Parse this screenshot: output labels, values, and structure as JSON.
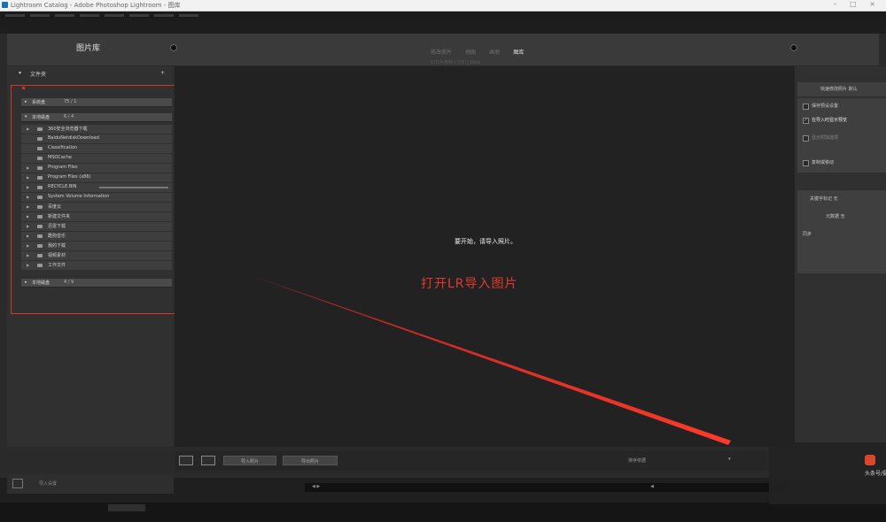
{
  "window": {
    "title": "Lightroom Catalog - Adobe Photoshop Lightroom - 图库",
    "controls": "– □ ×"
  },
  "identity": {
    "label": "图片库"
  },
  "modules": {
    "items": [
      "修改照片",
      "地图",
      "画册"
    ],
    "active": "图库",
    "sub": "幻灯片放映 | 打印 | Web"
  },
  "left_panel": {
    "header": "文件夹",
    "header_tri": "▾",
    "add": "+",
    "volumes": [
      {
        "name": "系统盘",
        "size": "75 / 1"
      },
      {
        "name": "本地磁盘",
        "size": "6 / 4"
      },
      {
        "name": "本地磁盘",
        "size": "4 / 9"
      }
    ],
    "folders": [
      "360安全浏览器下载",
      "BaiduNetdiskDownload",
      "Classification",
      "MSOCache",
      "Program Files",
      "Program Files (x86)",
      "RECYCLE.BIN",
      "System Volume Information",
      "百度云",
      "新建文件夹",
      "迅雷下载",
      "酷狗音乐",
      "我的下载",
      "视频素材",
      "工作文件"
    ]
  },
  "center": {
    "empty_message": "要开始，请导入照片。",
    "annotation": "打开LR导入图片"
  },
  "right_panel": {
    "quick_develop": "快速修改照片  默认",
    "options": [
      {
        "label": "保存预设设置",
        "checked": false
      },
      {
        "label": "在导入时显示预览",
        "checked": true
      },
      {
        "label": "显示附加选项",
        "checked": false
      },
      {
        "label": "复制或移动",
        "checked": false
      }
    ],
    "keywords": "关键字标记  无",
    "metadata": "元数据  无",
    "sync": "同步"
  },
  "toolbar": {
    "import_button": "导入照片",
    "export_button": "导出照片",
    "sort_label": "排序依据",
    "sort_tri": "▾"
  },
  "left_bottom": {
    "label": "导入设置"
  },
  "filmstrip": {
    "left_text": "◀  ▶",
    "right_text": "◀"
  },
  "watermark": {
    "text": "头条号/摄影"
  },
  "colors": {
    "annotation_red": "#d9322c",
    "panel_bg": "#303030",
    "grid_bg": "#222222"
  }
}
